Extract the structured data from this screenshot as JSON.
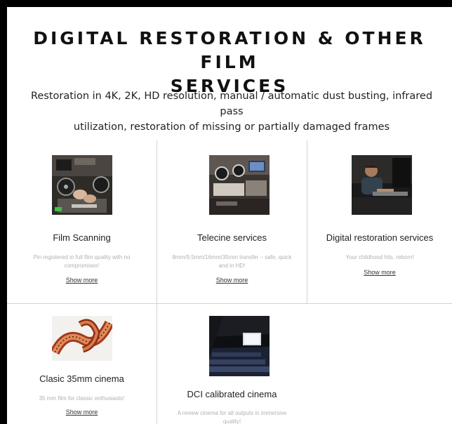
{
  "page": {
    "title_line1": "DIGITAL RESTORATION & OTHER FILM",
    "title_line2": "SERVICES",
    "subtitle_line1": "Restoration in 4K, 2K, HD resolution, manual / automatic dust busting, infrared pass",
    "subtitle_line2": "utilization, restoration of missing or partially damaged frames"
  },
  "services": [
    {
      "title": "Film Scanning",
      "desc_line1": "Pin registered in full film quality with no",
      "desc_line2": "compromises!",
      "link": "Show more"
    },
    {
      "title": "Telecine services",
      "desc_line1": "8mm/9,5mm/16mm/35mm transfer – safe, quick",
      "desc_line2": "and in HD!",
      "link": "Show more"
    },
    {
      "title": "Digital restoration services",
      "desc_line1": "Your childhood hits, reborn!",
      "link": "Show more"
    },
    {
      "title": "Clasic 35mm cinema",
      "desc_line1": "35 mm film for classic enthusiasts!",
      "link": "Show more"
    },
    {
      "title": "DCI calibrated cinema",
      "desc_line1": "A review cinema for all outputs in immersive",
      "desc_line2": "quality!"
    }
  ]
}
